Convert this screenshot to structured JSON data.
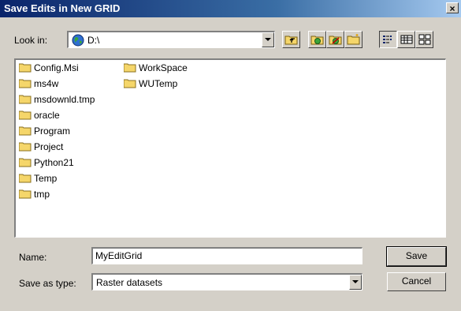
{
  "window": {
    "title": "Save Edits in New GRID",
    "close_label": "×"
  },
  "toolbar": {
    "lookin_label": "Look in:",
    "lookin_value": "D:\\",
    "buttons": [
      "up-one-level",
      "connect-folder",
      "disconnect-folder",
      "new-folder",
      "list-view",
      "details-view",
      "thumbnails-view"
    ]
  },
  "file_list": {
    "column1": [
      "Config.Msi",
      "ms4w",
      "msdownld.tmp",
      "oracle",
      "Program",
      "Project",
      "Python21",
      "Temp",
      "tmp"
    ],
    "column2": [
      "WorkSpace",
      "WUTemp"
    ]
  },
  "form": {
    "name_label": "Name:",
    "name_value": "MyEditGrid",
    "type_label": "Save as type:",
    "type_value": "Raster datasets"
  },
  "buttons": {
    "save_label": "Save",
    "cancel_label": "Cancel"
  },
  "colors": {
    "folder_yellow": "#f5d66a",
    "title_blue": "#0a246a",
    "dialog_gray": "#d4d0c8"
  }
}
